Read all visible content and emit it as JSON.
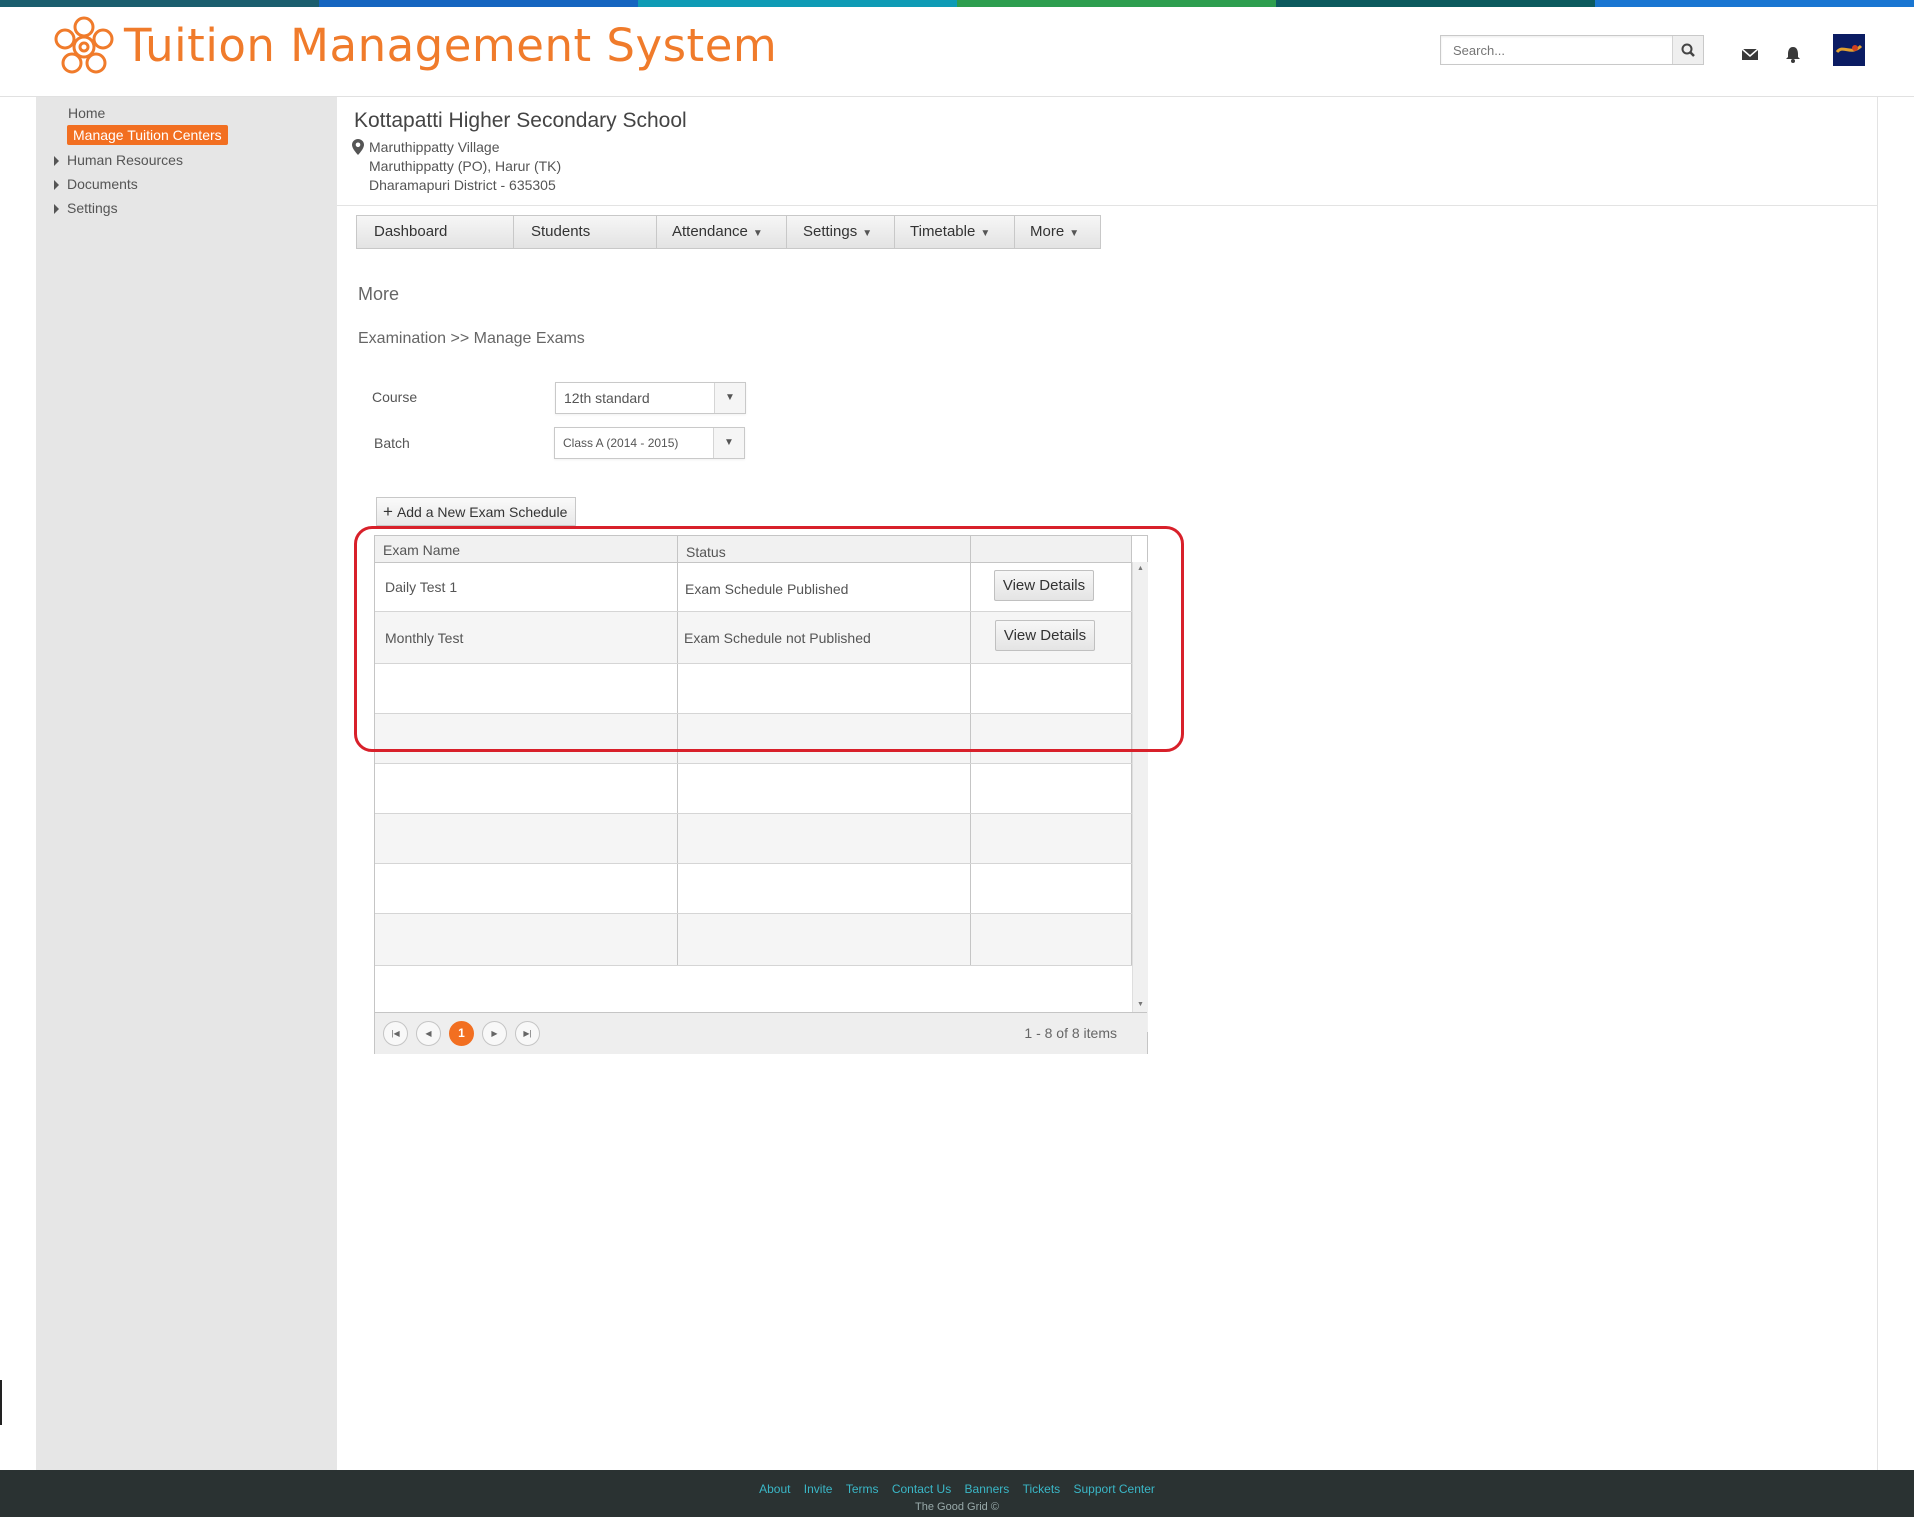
{
  "colors": {
    "accent": "#f26f21",
    "title": "#f07b2b",
    "stripe": [
      "#1b5e6e",
      "#1565c0",
      "#0e9bb5",
      "#2e9e4f",
      "#0c5a5e",
      "#1976d2"
    ],
    "footer_link": "#3ab7c7",
    "highlight": "#d8202a"
  },
  "header": {
    "app_title": "Tuition Management System",
    "search_placeholder": "Search...",
    "icons": [
      "logo-icon",
      "search-icon",
      "mail-icon",
      "bell-icon",
      "avatar"
    ]
  },
  "sidebar": {
    "items": [
      {
        "label": "Home",
        "active": false,
        "expandable": false
      },
      {
        "label": "Manage Tuition  Centers",
        "active": true,
        "expandable": false
      },
      {
        "label": "Human Resources",
        "active": false,
        "expandable": true
      },
      {
        "label": "Documents",
        "active": false,
        "expandable": true
      },
      {
        "label": "Settings",
        "active": false,
        "expandable": true
      }
    ]
  },
  "school": {
    "name": "Kottapatti Higher Secondary School",
    "address": [
      "Maruthippatty Village",
      "Maruthippatty (PO), Harur (TK)",
      "Dharamapuri District - 635305"
    ]
  },
  "tabs": [
    {
      "label": "Dashboard",
      "dropdown": false
    },
    {
      "label": "Students",
      "dropdown": false
    },
    {
      "label": "Attendance",
      "dropdown": true
    },
    {
      "label": "Settings",
      "dropdown": true
    },
    {
      "label": "Timetable",
      "dropdown": true
    },
    {
      "label": "More",
      "dropdown": true
    }
  ],
  "main": {
    "section_title": "More",
    "breadcrumb": "Examination >> Manage Exams",
    "form": {
      "course_label": "Course",
      "course_value": "12th standard",
      "batch_label": "Batch",
      "batch_value": "Class A (2014 - 2015)"
    },
    "add_button": "Add a New Exam Schedule"
  },
  "grid": {
    "columns": [
      "Exam Name",
      "Status",
      ""
    ],
    "rows": [
      {
        "exam_name": "Daily Test 1",
        "status": "Exam Schedule Published",
        "action": "View Details"
      },
      {
        "exam_name": "Monthly Test",
        "status": "Exam Schedule not Published",
        "action": "View Details"
      }
    ],
    "pager": {
      "current_page": "1",
      "info": "1 - 8 of 8 items"
    }
  },
  "footer": {
    "links": [
      "About",
      "Invite",
      "Terms",
      "Contact Us",
      "Banners",
      "Tickets",
      "Support Center"
    ],
    "copyright": "The Good Grid ©"
  }
}
